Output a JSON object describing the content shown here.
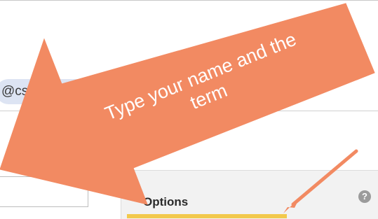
{
  "recipients": {
    "chip_text": "@csusb.edu",
    "chip_remove": "×"
  },
  "options": {
    "title": "Options",
    "help_icon_glyph": "?"
  },
  "annotation": {
    "text_line1": "Type your name and the",
    "text_line2": "term",
    "arrow_color": "#f28a62",
    "highlight_color": "#f2c94c"
  }
}
